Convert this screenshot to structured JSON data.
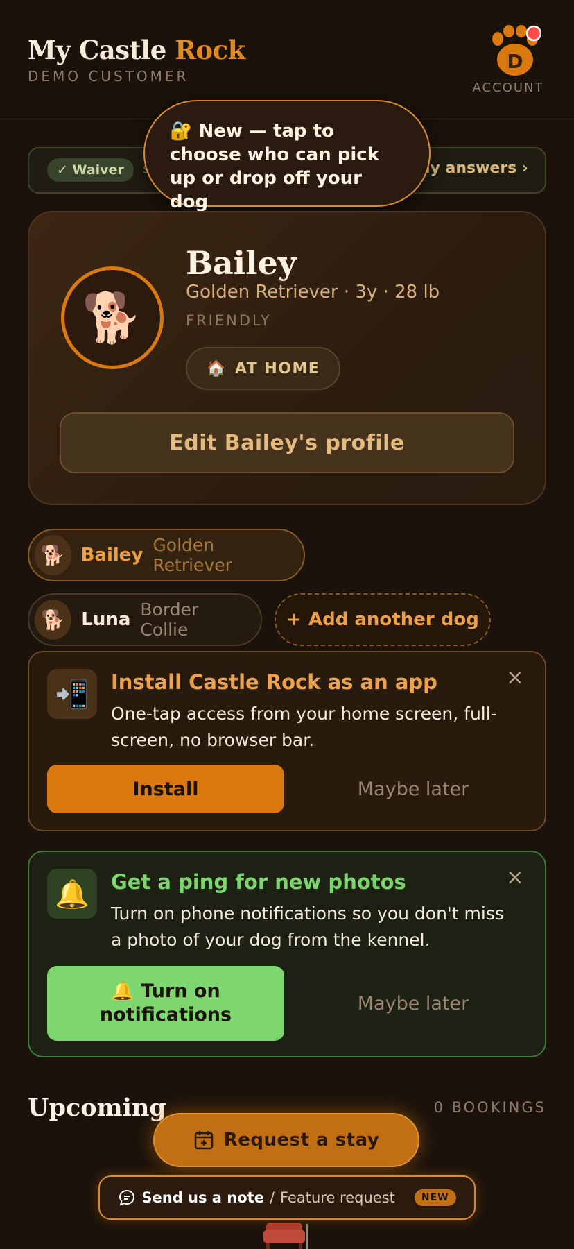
{
  "header": {
    "brand_main": "My Castle",
    "brand_accent": "Rock",
    "customer": "DEMO CUSTOMER",
    "account_initial": "D",
    "account_label": "ACCOUNT"
  },
  "waiver": {
    "badge": "✓ Waiver",
    "middle": "s",
    "link": "ny answers ›"
  },
  "tooltip": {
    "icon": "🔐",
    "text": "New — tap to choose who can pick up or drop off your dog"
  },
  "dog": {
    "emoji": "🐕",
    "name": "Bailey",
    "meta": "Golden Retriever · 3y · 28 lb",
    "temperament": "FRIENDLY",
    "status_icon": "🏠",
    "status": "AT HOME",
    "edit_label": "Edit Bailey's profile"
  },
  "dogs": [
    {
      "emoji": "🐕",
      "name": "Bailey",
      "breed": "Golden Retriever"
    },
    {
      "emoji": "🐕",
      "name": "Luna",
      "breed": "Border Collie"
    }
  ],
  "add_dog": {
    "icon": "+",
    "label": "Add another dog"
  },
  "install": {
    "icon": "📲",
    "title": "Install Castle Rock as an app",
    "text": "One-tap access from your home screen, full-screen, no browser bar.",
    "primary": "Install",
    "secondary": "Maybe later",
    "close": "×"
  },
  "notify": {
    "icon": "🔔",
    "title": "Get a ping for new photos",
    "text": "Turn on phone notifications so you don't miss a photo of your dog from the kennel.",
    "primary": "🔔 Turn on notifications",
    "secondary": "Maybe later",
    "close": "×"
  },
  "upcoming": {
    "title": "Upcoming",
    "count": "0 BOOKINGS"
  },
  "request": {
    "label": "Request a stay"
  },
  "note": {
    "strong": "Send us a note",
    "sep": "/",
    "muted": "Feature request",
    "badge": "NEW"
  },
  "colors": {
    "accent": "#d9790f",
    "background": "#1a120b",
    "success": "#7dd66e",
    "notification_dot": "#ff4b4b"
  }
}
